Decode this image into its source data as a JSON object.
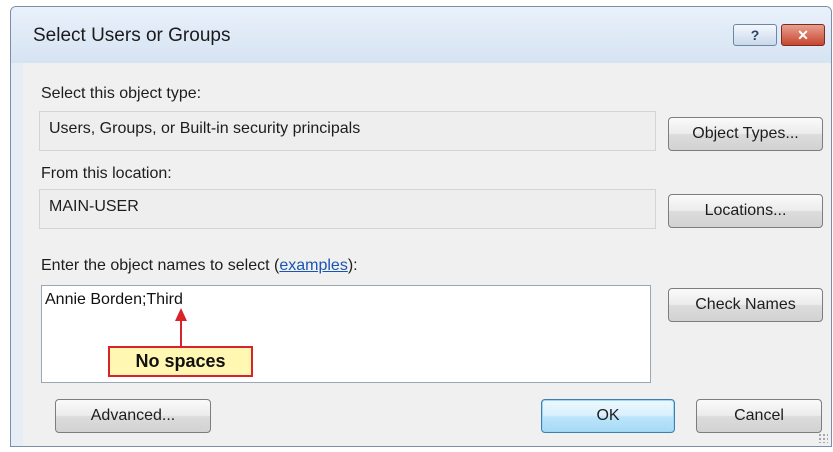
{
  "window": {
    "title": "Select Users or Groups",
    "help_glyph": "?",
    "close_glyph": "✕"
  },
  "object_type": {
    "label": "Select this object type:",
    "value": "Users, Groups, or Built-in security principals",
    "button_label": "Object Types..."
  },
  "location": {
    "label": "From this location:",
    "value": "MAIN-USER",
    "button_label": "Locations..."
  },
  "object_names": {
    "label_prefix": "Enter the object names to select (",
    "label_link": "examples",
    "label_suffix": "):",
    "value": "Annie Borden;Third",
    "check_button_label": "Check Names"
  },
  "footer": {
    "advanced_label": "Advanced...",
    "ok_label": "OK",
    "cancel_label": "Cancel"
  },
  "annotation": {
    "text": "No spaces",
    "color": "#d8232a",
    "fill": "#fff7b2"
  }
}
